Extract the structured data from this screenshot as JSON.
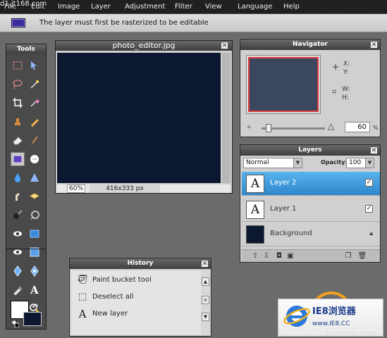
{
  "watermark": "d1.jt168.com",
  "menu": [
    "File",
    "Edit",
    "Image",
    "Layer",
    "Adjustment",
    "Filter",
    "View",
    "Language",
    "Help"
  ],
  "options_bar": {
    "message": "The layer must first be rasterized to be editable"
  },
  "tools": {
    "title": "Tools",
    "items": [
      "marquee-icon",
      "move-icon",
      "lasso-icon",
      "magic-wand-icon",
      "crop-icon",
      "wand-icon",
      "stamp-icon",
      "pencil-icon",
      "eraser-icon",
      "brush-icon",
      "color-replace-icon",
      "smudge-icon",
      "drop-icon",
      "sharpen-icon",
      "finger-icon",
      "sponge-icon",
      "burn-icon",
      "dodge-icon",
      "redeye-icon",
      "rect-shape-icon",
      "eye-icon",
      "square-icon",
      "pin-icon",
      "target-icon",
      "eyedropper-icon",
      "type-icon",
      "hand-icon",
      "zoom-icon"
    ],
    "colors": {
      "foreground": "#ffffff",
      "background": "#0c1730"
    }
  },
  "document": {
    "title": "photo_editor.jpg",
    "zoom": "60",
    "zoom_unit": "%",
    "size": "416x333 px",
    "canvas_color": "#0c1730"
  },
  "navigator": {
    "title": "Navigator",
    "x_label": "X:",
    "y_label": "Y:",
    "w_label": "W:",
    "h_label": "H:",
    "zoom": "60",
    "zoom_unit": "%"
  },
  "layers": {
    "title": "Layers",
    "blend_mode": "Normal",
    "opacity_label": "Opacity:",
    "opacity": "100",
    "items": [
      {
        "name": "Layer 2",
        "thumb": "A",
        "selected": true
      },
      {
        "name": "Layer 1",
        "thumb": "A",
        "selected": false
      },
      {
        "name": "Background",
        "thumb": "",
        "selected": false
      }
    ]
  },
  "history": {
    "title": "History",
    "items": [
      {
        "label": "Paint bucket tool"
      },
      {
        "label": "Deselect all"
      },
      {
        "label": "New layer"
      }
    ]
  },
  "logo": {
    "name": "IE8浏览器",
    "url": "www.IE8.CC",
    "fps": "101 FPS 83.71 MB"
  }
}
